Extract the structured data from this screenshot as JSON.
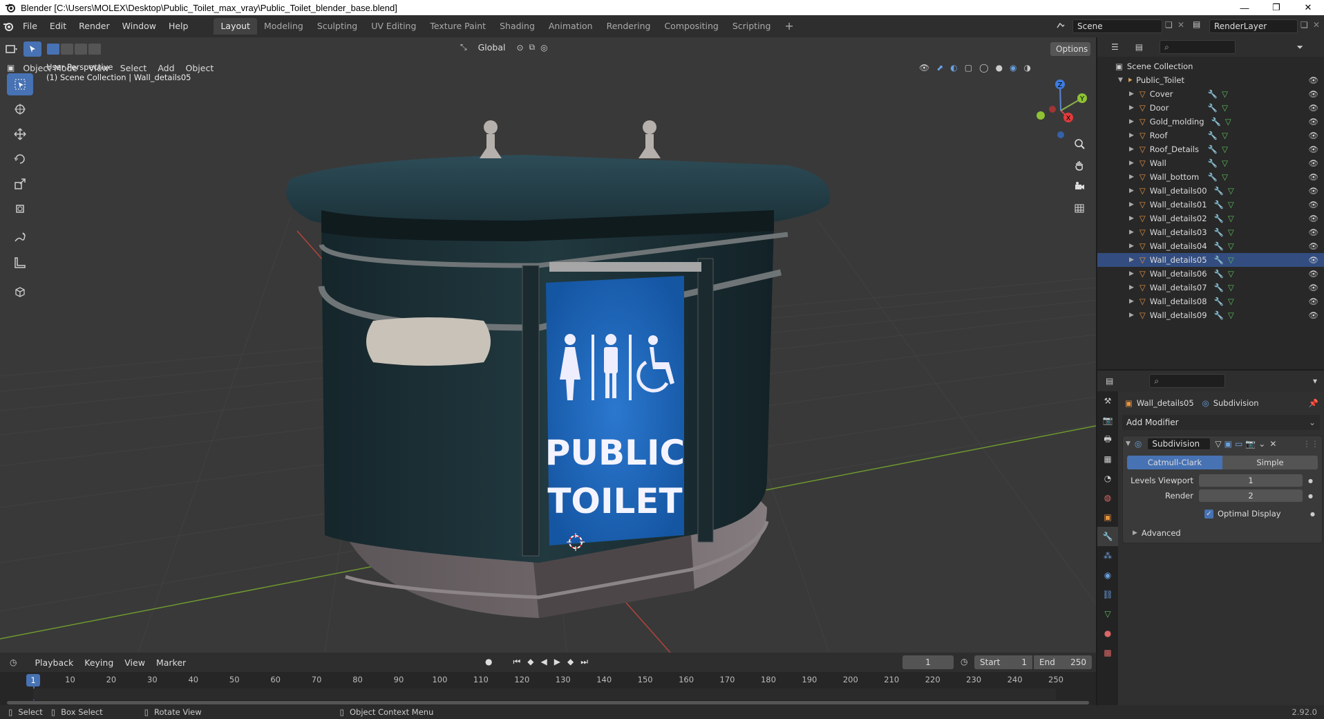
{
  "window": {
    "title": "Blender [C:\\Users\\MOLEX\\Desktop\\Public_Toilet_max_vray\\Public_Toilet_blender_base.blend]",
    "min": "—",
    "max": "❐",
    "close": "✕"
  },
  "menus": [
    "File",
    "Edit",
    "Render",
    "Window",
    "Help"
  ],
  "workspaces": [
    "Layout",
    "Modeling",
    "Sculpting",
    "UV Editing",
    "Texture Paint",
    "Shading",
    "Animation",
    "Rendering",
    "Compositing",
    "Scripting"
  ],
  "scene": {
    "name": "Scene",
    "layer": "RenderLayer"
  },
  "viewport": {
    "mode": "Object Mode",
    "menus": [
      "View",
      "Select",
      "Add",
      "Object"
    ],
    "transform": "Global",
    "options": "Options",
    "info1": "User Perspective",
    "info2": "(1) Scene Collection | Wall_details05"
  },
  "model": {
    "sign_line1": "PUBLIC",
    "sign_line2": "TOILET"
  },
  "outliner": {
    "root": "Scene Collection",
    "collection": "Public_Toilet",
    "items": [
      "Cover",
      "Door",
      "Gold_molding",
      "Roof",
      "Roof_Details",
      "Wall",
      "Wall_bottom",
      "Wall_details00",
      "Wall_details01",
      "Wall_details02",
      "Wall_details03",
      "Wall_details04",
      "Wall_details05",
      "Wall_details06",
      "Wall_details07",
      "Wall_details08",
      "Wall_details09"
    ],
    "selected": 12
  },
  "properties": {
    "object": "Wall_details05",
    "modifier_ctx": "Subdivision",
    "add_modifier": "Add Modifier",
    "mod_name": "Subdivision",
    "catmull": "Catmull-Clark",
    "simple": "Simple",
    "levels_label": "Levels Viewport",
    "levels_value": "1",
    "render_label": "Render",
    "render_value": "2",
    "optimal": "Optimal Display",
    "advanced": "Advanced"
  },
  "timeline": {
    "menus": [
      "Playback",
      "Keying",
      "View",
      "Marker"
    ],
    "current": "1",
    "start_label": "Start",
    "start": "1",
    "end_label": "End",
    "end": "250",
    "ticks": [
      "10",
      "20",
      "30",
      "40",
      "50",
      "60",
      "70",
      "80",
      "90",
      "100",
      "110",
      "120",
      "130",
      "140",
      "150",
      "160",
      "170",
      "180",
      "190",
      "200",
      "210",
      "220",
      "230",
      "240",
      "250"
    ],
    "cursor_label": "1"
  },
  "status": {
    "select": "Select",
    "box": "Box Select",
    "rotate": "Rotate View",
    "ctx": "Object Context Menu",
    "version": "2.92.0"
  },
  "colors": {
    "accent": "#4772b3",
    "header": "#2e2e2e",
    "viewport": "#393939",
    "x_axis": "#b3443a",
    "y_axis": "#6e9a2e",
    "sign": "#1d64b4"
  }
}
